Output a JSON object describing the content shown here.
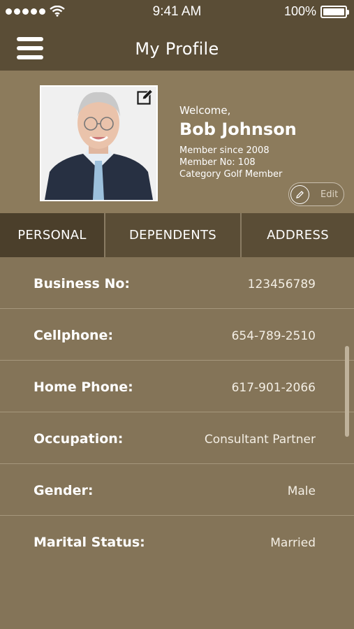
{
  "status_bar": {
    "time": "9:41 AM",
    "battery": "100%",
    "battery_level": 1.0,
    "icons": [
      "signal-icon",
      "wifi-icon",
      "battery-icon"
    ]
  },
  "nav": {
    "title": "My Profile",
    "menu_icon": "hamburger-menu-icon"
  },
  "profile": {
    "welcome": "Welcome,",
    "name": "Bob Johnson",
    "member_since": "Member since 2008",
    "member_no": "Member No: 108",
    "category": "Category Golf Member",
    "edit_label": "Edit",
    "photo_edit_icon": "pencil-square-icon"
  },
  "tabs": [
    {
      "label": "PERSONAL",
      "selected": true
    },
    {
      "label": "DEPENDENTS",
      "selected": false
    },
    {
      "label": "ADDRESS",
      "selected": false
    }
  ],
  "details": [
    {
      "label": "Business No:",
      "value": "123456789"
    },
    {
      "label": "Cellphone:",
      "value": "654-789-2510"
    },
    {
      "label": "Home Phone:",
      "value": "617-901-2066"
    },
    {
      "label": "Occupation:",
      "value": "Consultant Partner"
    },
    {
      "label": "Gender:",
      "value": "Male"
    },
    {
      "label": "Marital Status:",
      "value": "Married"
    }
  ],
  "colors": {
    "header": "#5a4d36",
    "background": "#847458",
    "selected_tab": "#4b3f2b"
  }
}
